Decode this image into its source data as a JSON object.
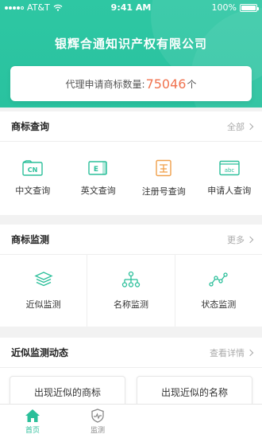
{
  "status_bar": {
    "carrier": "AT&T",
    "time": "9:41 AM",
    "battery": "100%"
  },
  "header": {
    "company": "银辉合通知识产权有限公司"
  },
  "stats": {
    "prefix": "代理申请商标数量: ",
    "count": "75046",
    "suffix": "个"
  },
  "trademark_search": {
    "title": "商标查询",
    "more": "全部",
    "items": [
      {
        "label": "中文查询",
        "icon": "cn-icon"
      },
      {
        "label": "英文查询",
        "icon": "en-icon"
      },
      {
        "label": "注册号查询",
        "icon": "register-number-icon"
      },
      {
        "label": "申请人查询",
        "icon": "applicant-icon"
      }
    ]
  },
  "trademark_monitor": {
    "title": "商标监测",
    "more": "更多",
    "items": [
      {
        "label": "近似监测",
        "icon": "layers-icon"
      },
      {
        "label": "名称监测",
        "icon": "hierarchy-icon"
      },
      {
        "label": "状态监测",
        "icon": "trend-icon"
      }
    ]
  },
  "similar_dynamics": {
    "title": "近似监测动态",
    "more": "查看详情",
    "cards": [
      "出现近似的商标",
      "出现近似的名称"
    ]
  },
  "tabbar": {
    "tabs": [
      {
        "label": "首页",
        "active": true
      },
      {
        "label": "监测",
        "active": false
      }
    ]
  },
  "colors": {
    "brand": "#2ec7a3",
    "accent_number": "#f0734f",
    "icon_orange": "#f0a04b"
  }
}
